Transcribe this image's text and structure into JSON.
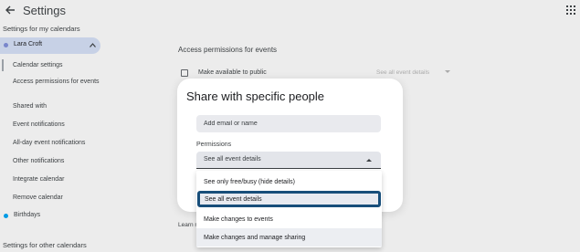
{
  "header": {
    "title": "Settings",
    "back_icon": "arrow-left-icon",
    "apps_icon": "apps-grid-icon"
  },
  "sidebar": {
    "my_calendars_heading": "Settings for my calendars",
    "calendar_name": "Lara Croft",
    "calendar_color": "#7986cb",
    "items": [
      {
        "label": "Calendar settings"
      },
      {
        "label": "Access permissions for events"
      },
      {
        "label": "Shared with"
      },
      {
        "label": "Event notifications"
      },
      {
        "label": "All-day event notifications"
      },
      {
        "label": "Other notifications"
      },
      {
        "label": "Integrate calendar"
      },
      {
        "label": "Remove calendar"
      }
    ],
    "birthdays_label": "Birthdays",
    "birthdays_color": "#039be5",
    "other_calendars_heading": "Settings for other calendars"
  },
  "main": {
    "section_heading": "Access permissions for events",
    "public_label": "Make available to public",
    "public_select_value": "See all event details",
    "learn_more_prefix": "Learn m"
  },
  "dialog": {
    "title": "Share with specific people",
    "email_placeholder": "Add email or name",
    "permissions_label": "Permissions",
    "permissions_value": "See all event details",
    "options": [
      {
        "label": "See only free/busy (hide details)"
      },
      {
        "label": "See all event details"
      },
      {
        "label": "Make changes to events"
      },
      {
        "label": "Make changes and manage sharing"
      }
    ],
    "selected_index": 1,
    "accent_color": "#184e7a"
  }
}
